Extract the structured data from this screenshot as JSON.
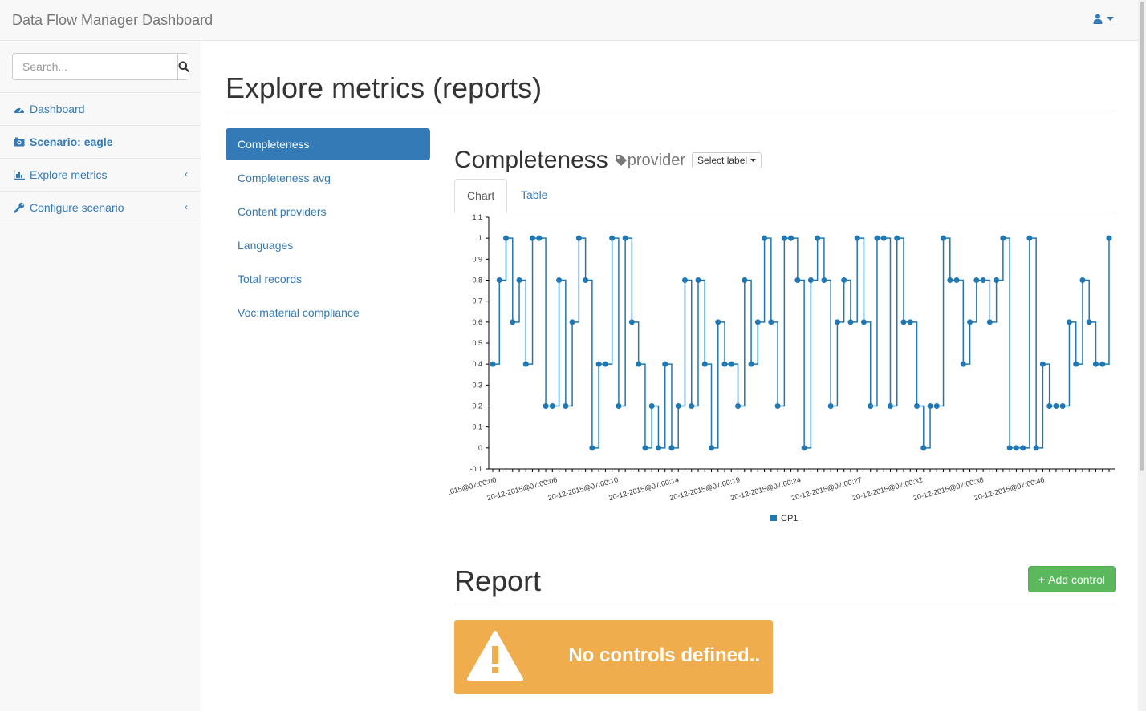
{
  "navbar": {
    "brand": "Data Flow Manager Dashboard"
  },
  "sidebar": {
    "search_placeholder": "Search...",
    "items": [
      {
        "label": "Dashboard",
        "icon": "dashboard-icon"
      },
      {
        "label": "Scenario: eagle",
        "icon": "camera-icon"
      },
      {
        "label": "Explore metrics",
        "icon": "bar-chart-icon"
      },
      {
        "label": "Configure scenario",
        "icon": "wrench-icon"
      }
    ]
  },
  "page": {
    "title": "Explore metrics (reports)"
  },
  "metrics": [
    "Completeness",
    "Completeness avg",
    "Content providers",
    "Languages",
    "Total records",
    "Voc:material compliance"
  ],
  "panel": {
    "title": "Completeness",
    "tag": "provider",
    "select_label": "Select label",
    "tabs": [
      "Chart",
      "Table"
    ]
  },
  "report": {
    "title": "Report",
    "add_button": "Add control",
    "alert": "No controls defined.."
  },
  "colors": {
    "primary": "#337ab7",
    "success": "#5cb85c",
    "warning": "#f0ad4e",
    "series": "#1f77b4"
  },
  "chart_data": {
    "type": "line",
    "interpolation": "step",
    "ylim": [
      -0.1,
      1.1
    ],
    "yticks": [
      -0.1,
      0,
      0.1,
      0.2,
      0.3,
      0.4,
      0.5,
      0.6,
      0.7,
      0.8,
      0.9,
      1,
      1.1
    ],
    "xtick_labels": [
      "20-12-2015@07:00:00",
      "20-12-2015@07:00:06",
      "20-12-2015@07:00:10",
      "20-12-2015@07:00:14",
      "20-12-2015@07:00:19",
      "20-12-2015@07:00:24",
      "20-12-2015@07:00:27",
      "20-12-2015@07:00:32",
      "20-12-2015@07:00:38",
      "20-12-2015@07:00:46"
    ],
    "legend": "bottom-center",
    "series": [
      {
        "name": "CP1",
        "values": [
          0.4,
          0.8,
          1,
          0.6,
          0.8,
          0.4,
          1,
          1,
          0.2,
          0.2,
          0.8,
          0.2,
          0.6,
          1,
          0.8,
          0,
          0.4,
          0.4,
          1,
          0.2,
          1,
          0.6,
          0.4,
          0,
          0.2,
          0,
          0.4,
          0,
          0.2,
          0.8,
          0.2,
          0.8,
          0.4,
          0,
          0.6,
          0.4,
          0.4,
          0.2,
          0.8,
          0.4,
          0.6,
          1,
          0.6,
          0.2,
          1,
          1,
          0.8,
          0,
          0.8,
          1,
          0.8,
          0.2,
          0.6,
          0.8,
          0.6,
          1,
          0.6,
          0.2,
          1,
          1,
          0.2,
          1,
          0.6,
          0.6,
          0.2,
          0,
          0.2,
          0.2,
          1,
          0.8,
          0.8,
          0.4,
          0.6,
          0.8,
          0.8,
          0.6,
          0.8,
          1,
          0,
          0,
          0,
          1,
          0,
          0.4,
          0.2,
          0.2,
          0.2,
          0.6,
          0.4,
          0.8,
          0.6,
          0.4,
          0.4,
          1
        ]
      }
    ]
  }
}
